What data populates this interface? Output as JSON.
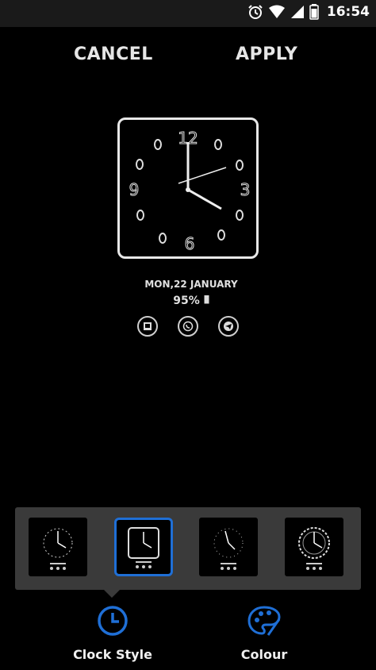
{
  "status_bar": {
    "time": "16:54",
    "icons": [
      "alarm-icon",
      "wifi-icon",
      "signal-icon",
      "battery-icon"
    ]
  },
  "actions": {
    "cancel": "CANCEL",
    "apply": "APPLY"
  },
  "preview": {
    "clock_numbers": [
      "12",
      "3",
      "6",
      "9"
    ],
    "date": "MON,22 JANUARY",
    "battery": "95%",
    "notification_icons": [
      "gallery-icon",
      "whatsapp-icon",
      "telegram-icon"
    ]
  },
  "styles": {
    "selected_index": 1,
    "thumbnails": [
      "analog-clock-style-1",
      "square-clock-style-2",
      "analog-clock-style-3",
      "analog-clock-style-4"
    ]
  },
  "bottom_nav": {
    "clock_style": "Clock Style",
    "colour": "Colour"
  },
  "colors": {
    "accent": "#1f6fd6",
    "background": "#000000",
    "panel": "#3a3a3a"
  }
}
